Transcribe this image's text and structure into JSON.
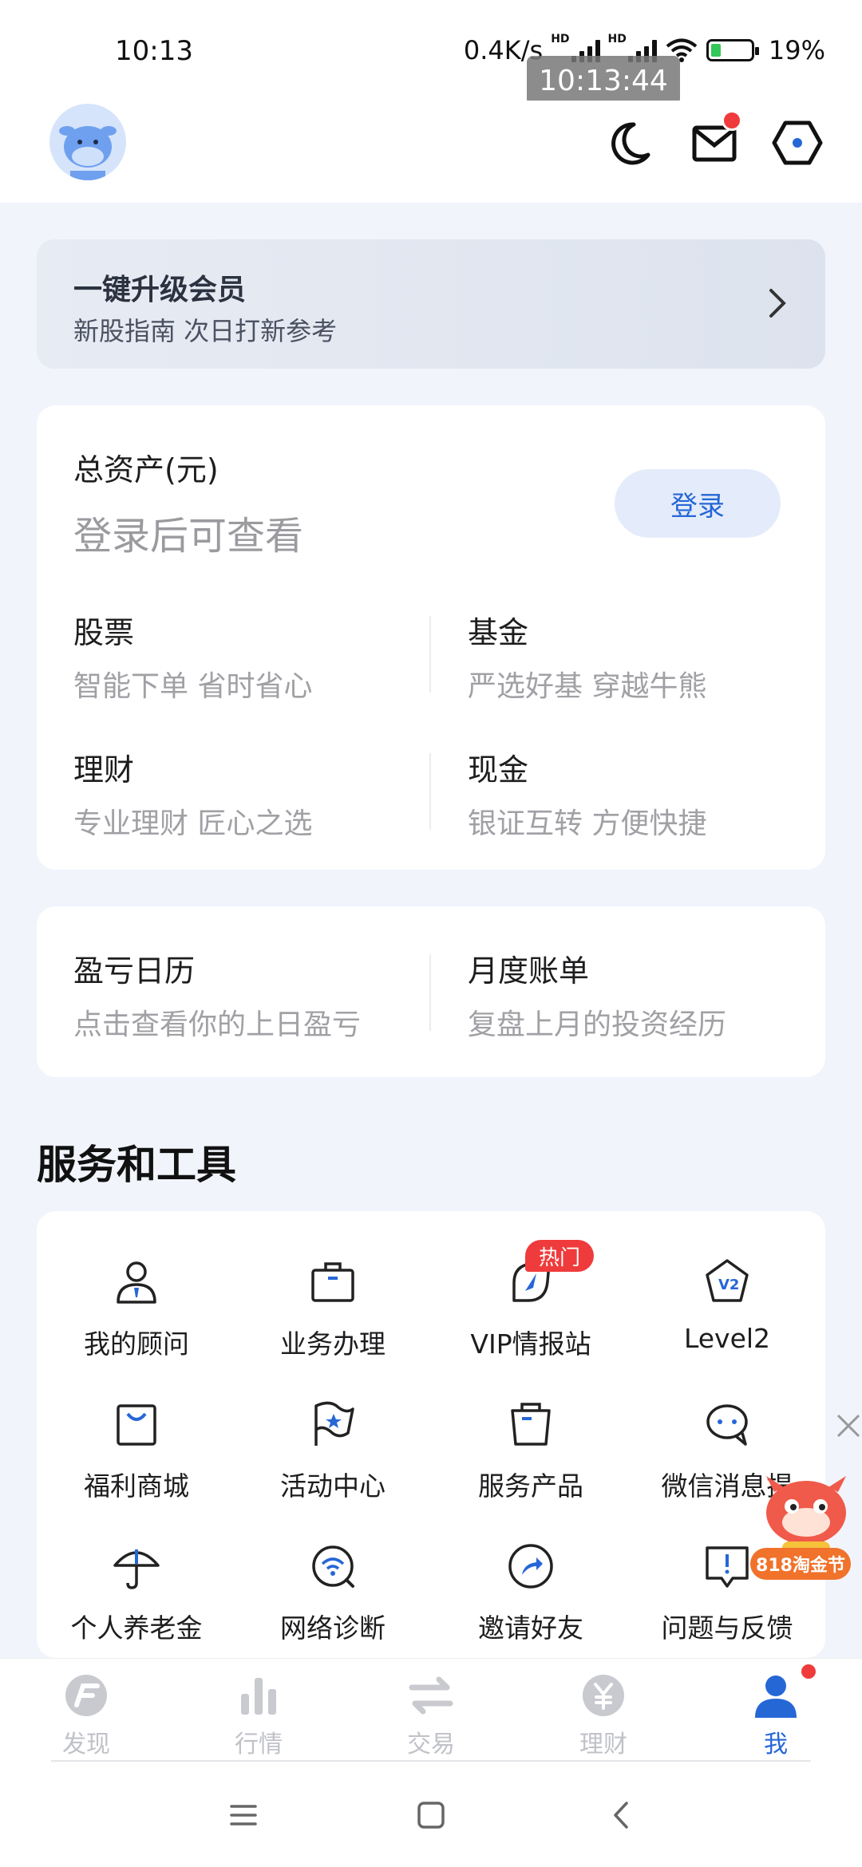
{
  "status_bar": {
    "time": "10:13",
    "net_speed": "0.4K/s",
    "hd1": "HD",
    "hd2": "HD",
    "battery": "19%",
    "overlay_time": "10:13:44"
  },
  "banner": {
    "title": "一键升级会员",
    "subtitle": "新股指南 次日打新参考"
  },
  "assets": {
    "title": "总资产(元)",
    "hint": "登录后可查看",
    "login_label": "登录",
    "items": [
      {
        "title": "股票",
        "sub": "智能下单 省时省心"
      },
      {
        "title": "基金",
        "sub": "严选好基 穿越牛熊"
      },
      {
        "title": "理财",
        "sub": "专业理财 匠心之选"
      },
      {
        "title": "现金",
        "sub": "银证互转 方便快捷"
      }
    ]
  },
  "records": {
    "items": [
      {
        "title": "盈亏日历",
        "sub": "点击查看你的上日盈亏"
      },
      {
        "title": "月度账单",
        "sub": "复盘上月的投资经历"
      }
    ]
  },
  "services": {
    "title": "服务和工具",
    "hot_badge": "热门",
    "tools": [
      {
        "label": "我的顾问",
        "icon": "advisor-icon"
      },
      {
        "label": "业务办理",
        "icon": "briefcase-icon"
      },
      {
        "label": "VIP情报站",
        "icon": "compass-icon"
      },
      {
        "label": "Level2",
        "icon": "level2-icon"
      },
      {
        "label": "福利商城",
        "icon": "shopping-bag-icon"
      },
      {
        "label": "活动中心",
        "icon": "flag-icon"
      },
      {
        "label": "服务产品",
        "icon": "clipboard-icon"
      },
      {
        "label": "微信消息提",
        "icon": "chat-icon"
      },
      {
        "label": "个人养老金",
        "icon": "umbrella-icon"
      },
      {
        "label": "网络诊断",
        "icon": "wifi-search-icon"
      },
      {
        "label": "邀请好友",
        "icon": "share-icon"
      },
      {
        "label": "问题与反馈",
        "icon": "feedback-icon"
      }
    ]
  },
  "promo": {
    "label": "818淘金节"
  },
  "bottom_nav": {
    "items": [
      {
        "label": "发现"
      },
      {
        "label": "行情"
      },
      {
        "label": "交易"
      },
      {
        "label": "理财"
      },
      {
        "label": "我"
      }
    ]
  },
  "colors": {
    "accent": "#2667d6",
    "background": "#f1f4fb",
    "badge_red": "#ef3b3b"
  }
}
